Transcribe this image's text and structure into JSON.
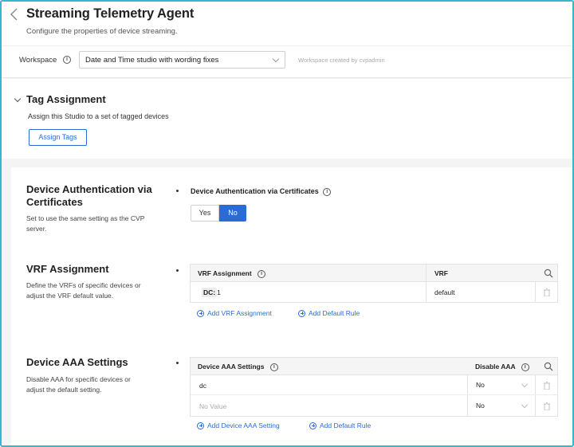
{
  "header": {
    "title": "Streaming Telemetry Agent",
    "subtitle": "Configure the properties of device streaming.",
    "workspace_label": "Workspace",
    "workspace_value": "Date and Time studio with wording fixes",
    "workspace_created": "Workspace created by cvpadmin"
  },
  "tag_assignment": {
    "title": "Tag Assignment",
    "description": "Assign this Studio to a set of tagged devices",
    "button_label": "Assign Tags"
  },
  "device_auth": {
    "title_line1": "Device Authentication via",
    "title_line2": "Certificates",
    "desc_line1": "Set to use the same setting as the CVP",
    "desc_line2": "server.",
    "field_label": "Device Authentication via Certificates",
    "options": [
      "Yes",
      "No"
    ],
    "selected": "No"
  },
  "vrf": {
    "title": "VRF Assignment",
    "desc_line1": "Define the VRFs of specific devices or",
    "desc_line2": "adjust the VRF default value.",
    "columns": [
      "VRF Assignment",
      "VRF"
    ],
    "rows": [
      {
        "tag_key": "DC:",
        "tag_value": "1",
        "vrf": "default"
      }
    ],
    "add_link": "Add VRF Assignment",
    "default_link": "Add Default Rule"
  },
  "aaa": {
    "title": "Device AAA Settings",
    "desc_line1": "Disable AAA for specific devices or",
    "desc_line2": "adjust the default setting.",
    "columns": [
      "Device AAA Settings",
      "Disable AAA"
    ],
    "rows": [
      {
        "device": "dc",
        "disable": "No",
        "placeholder": false
      },
      {
        "device": "No Value",
        "disable": "No",
        "placeholder": true
      }
    ],
    "add_link": "Add Device AAA Setting",
    "default_link": "Add Default Rule"
  },
  "colors": {
    "accent": "#2b6cd4",
    "frame": "#35b8c8"
  }
}
